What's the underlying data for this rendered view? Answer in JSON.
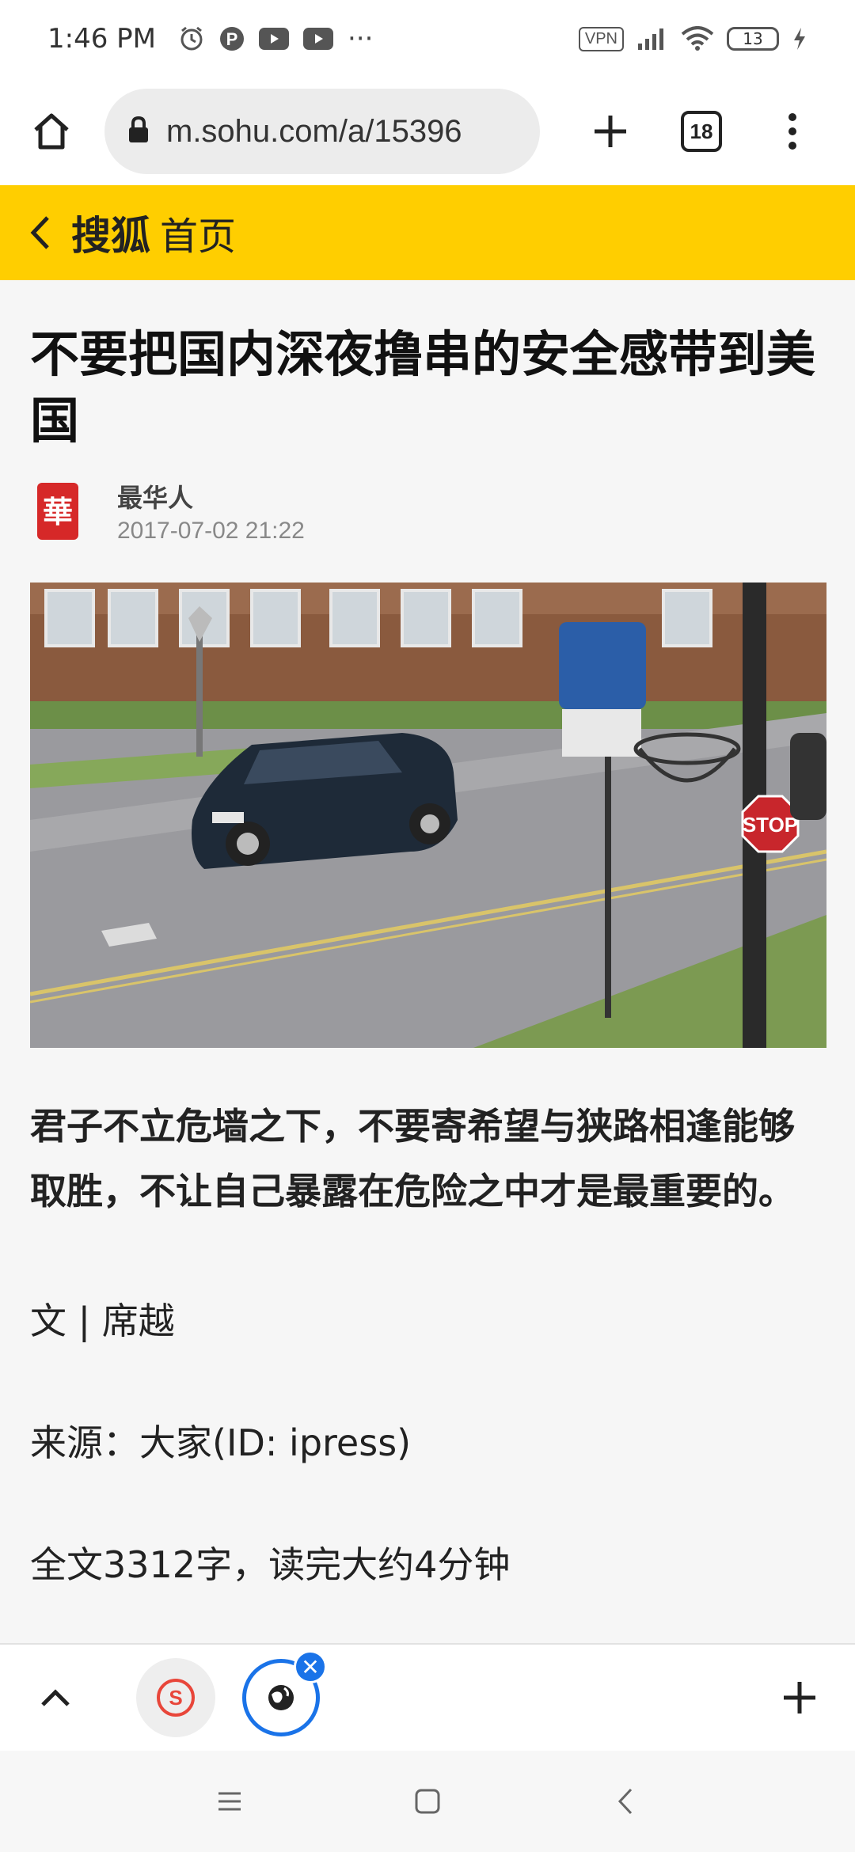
{
  "status_bar": {
    "time": "1:46 PM",
    "vpn": "VPN",
    "battery": "13",
    "more": "···"
  },
  "browser": {
    "url": "m.sohu.com/a/15396",
    "tab_count": "18"
  },
  "site_header": {
    "logo": "搜狐",
    "home_label": "首页",
    "accent_color": "#ffce00"
  },
  "article": {
    "title": "不要把国内深夜撸串的安全感带到美国",
    "author": "最华人",
    "date": "2017-07-02 21:22",
    "avatar_char": "華",
    "lead": "君子不立危墙之下，不要寄希望与狭路相逢能够取胜，不让自己暴露在危险之中才是最重要的。",
    "byline": "文 | 席越",
    "source": "来源：大家(ID: ipress)",
    "word_count": "全文3312字，读完大约4分钟",
    "image_sign": "STOP"
  },
  "icons": {
    "status": [
      "alarm-icon",
      "pinterest-icon",
      "youtube-icon",
      "youtube-icon",
      "signal-icon",
      "wifi-icon",
      "battery-icon",
      "charging-icon"
    ],
    "toolbar": [
      "home-icon",
      "lock-icon",
      "plus-icon",
      "tabs-icon",
      "more-vert-icon"
    ],
    "bottom": [
      "chevron-up-icon",
      "sohu-tab-icon",
      "globe-tab-icon",
      "close-icon",
      "plus-icon"
    ],
    "system": [
      "menu-icon",
      "home-square-icon",
      "back-icon"
    ]
  }
}
